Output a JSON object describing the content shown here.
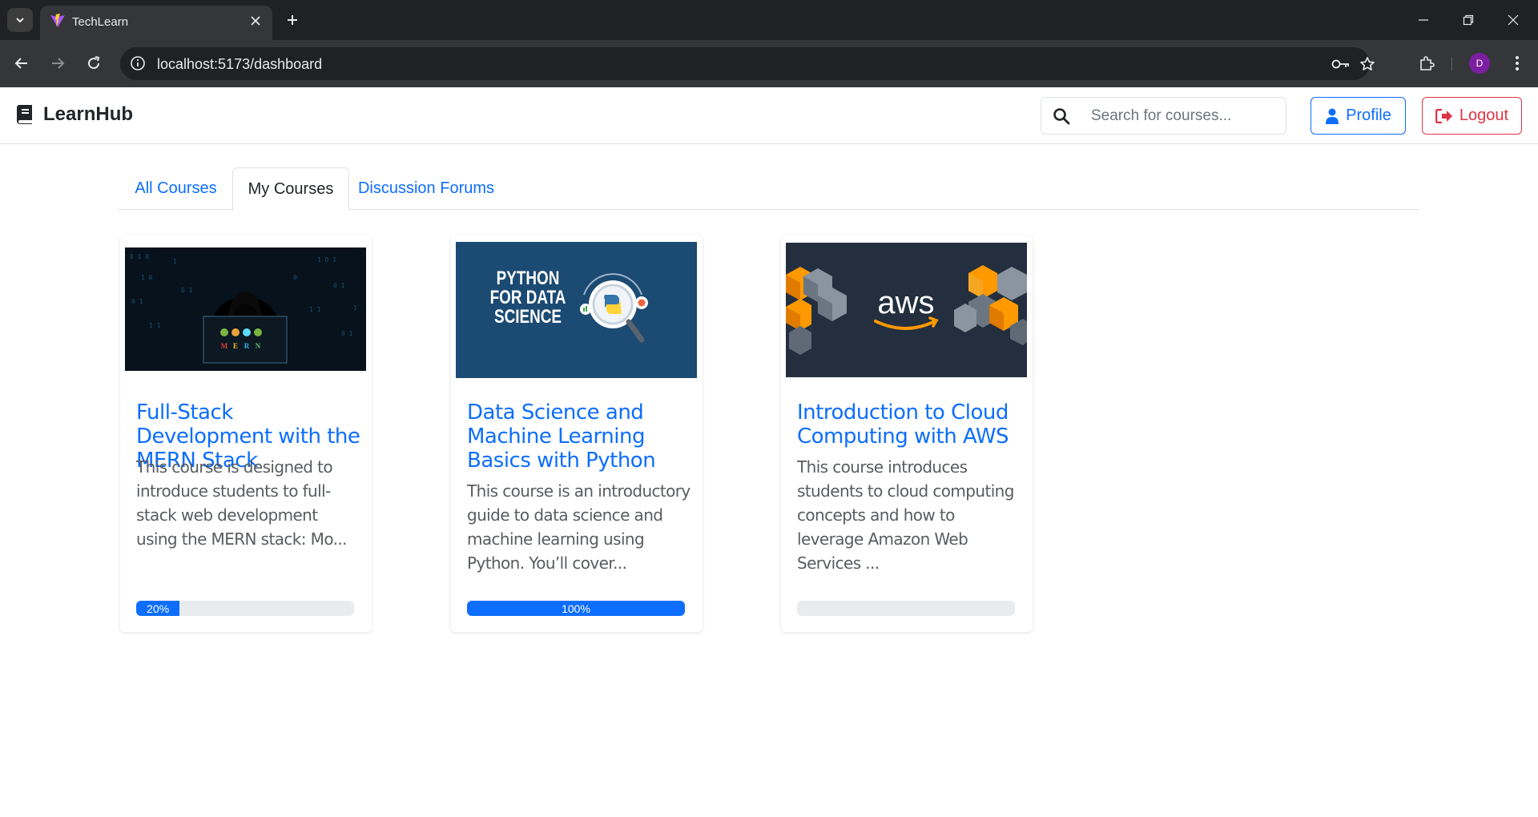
{
  "browser": {
    "tab_title": "TechLearn",
    "url": "localhost:5173/dashboard",
    "profile_initial": "D"
  },
  "app": {
    "brand": "LearnHub",
    "search_placeholder": "Search for courses...",
    "profile_label": "Profile",
    "logout_label": "Logout"
  },
  "tabs": [
    {
      "label": "All Courses",
      "active": false
    },
    {
      "label": "My Courses",
      "active": true
    },
    {
      "label": "Discussion Forums",
      "active": false
    }
  ],
  "courses": [
    {
      "title": "Full-Stack Development with the MERN Stack",
      "description": "This course is designed to introduce students to full-stack web development using the MERN stack: Mo...",
      "progress": 20,
      "progress_label": "20%",
      "image": {
        "letters": [
          "M",
          "E",
          "R",
          "N"
        ]
      }
    },
    {
      "title": "Data Science and Machine Learning Basics with Python",
      "description": "This course is an introductory guide to data science and machine learning using Python. You’ll cover...",
      "progress": 100,
      "progress_label": "100%",
      "image": {
        "text_lines": [
          "PYTHON",
          "FOR DATA",
          "SCIENCE"
        ]
      }
    },
    {
      "title": "Introduction to Cloud Computing with AWS",
      "description": "This course introduces students to cloud computing concepts and how to leverage Amazon Web Services ...",
      "progress": 0,
      "progress_label": "",
      "image": {
        "logo_text": "aws"
      }
    }
  ],
  "colors": {
    "primary": "#0d6efd",
    "danger": "#dc3545",
    "aws_orange": "#ff9900",
    "python_blue": "#1b4a73"
  }
}
